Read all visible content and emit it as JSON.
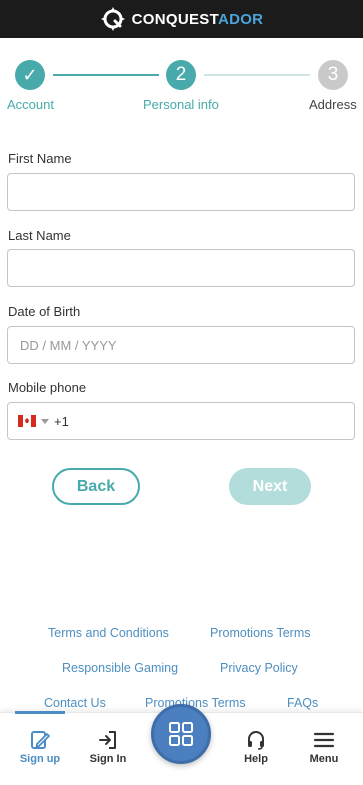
{
  "brand": {
    "part1": "CONQUEST",
    "part2": "ADOR",
    "icon": "compass-logo-icon"
  },
  "stepper": {
    "steps": [
      {
        "label": "Account",
        "marker": "✓",
        "state": "done"
      },
      {
        "label": "Personal info",
        "marker": "2",
        "state": "current"
      },
      {
        "label": "Address",
        "marker": "3",
        "state": "upcoming"
      }
    ]
  },
  "form": {
    "first_name": {
      "label": "First Name",
      "value": "",
      "placeholder": ""
    },
    "last_name": {
      "label": "Last Name",
      "value": "",
      "placeholder": ""
    },
    "dob": {
      "label": "Date of Birth",
      "value": "",
      "placeholder": "DD / MM / YYYY"
    },
    "mobile": {
      "label": "Mobile phone",
      "country_icon": "canada-flag-icon",
      "dial_code": "+1",
      "value": ""
    }
  },
  "buttons": {
    "back": "Back",
    "next": "Next"
  },
  "footer_links": {
    "terms": "Terms and Conditions",
    "promotions_terms": "Promotions Terms",
    "responsible_gaming": "Responsible Gaming",
    "privacy_policy": "Privacy Policy",
    "contact_us": "Contact Us",
    "promotions_terms_2": "Promotions Terms",
    "faqs": "FAQs"
  },
  "bottom_nav": {
    "signup": {
      "label": "Sign up",
      "icon": "edit-pencil-icon"
    },
    "signin": {
      "label": "Sign In",
      "icon": "sign-in-arrow-icon"
    },
    "games": {
      "icon": "grid-icon"
    },
    "help": {
      "label": "Help",
      "icon": "headset-icon"
    },
    "menu": {
      "label": "Menu",
      "icon": "hamburger-menu-icon"
    }
  },
  "colors": {
    "accent": "#48aaaa",
    "link": "#4d8fc1",
    "header_bg": "#1b1b1b",
    "nav_active": "#4a8cc4"
  }
}
